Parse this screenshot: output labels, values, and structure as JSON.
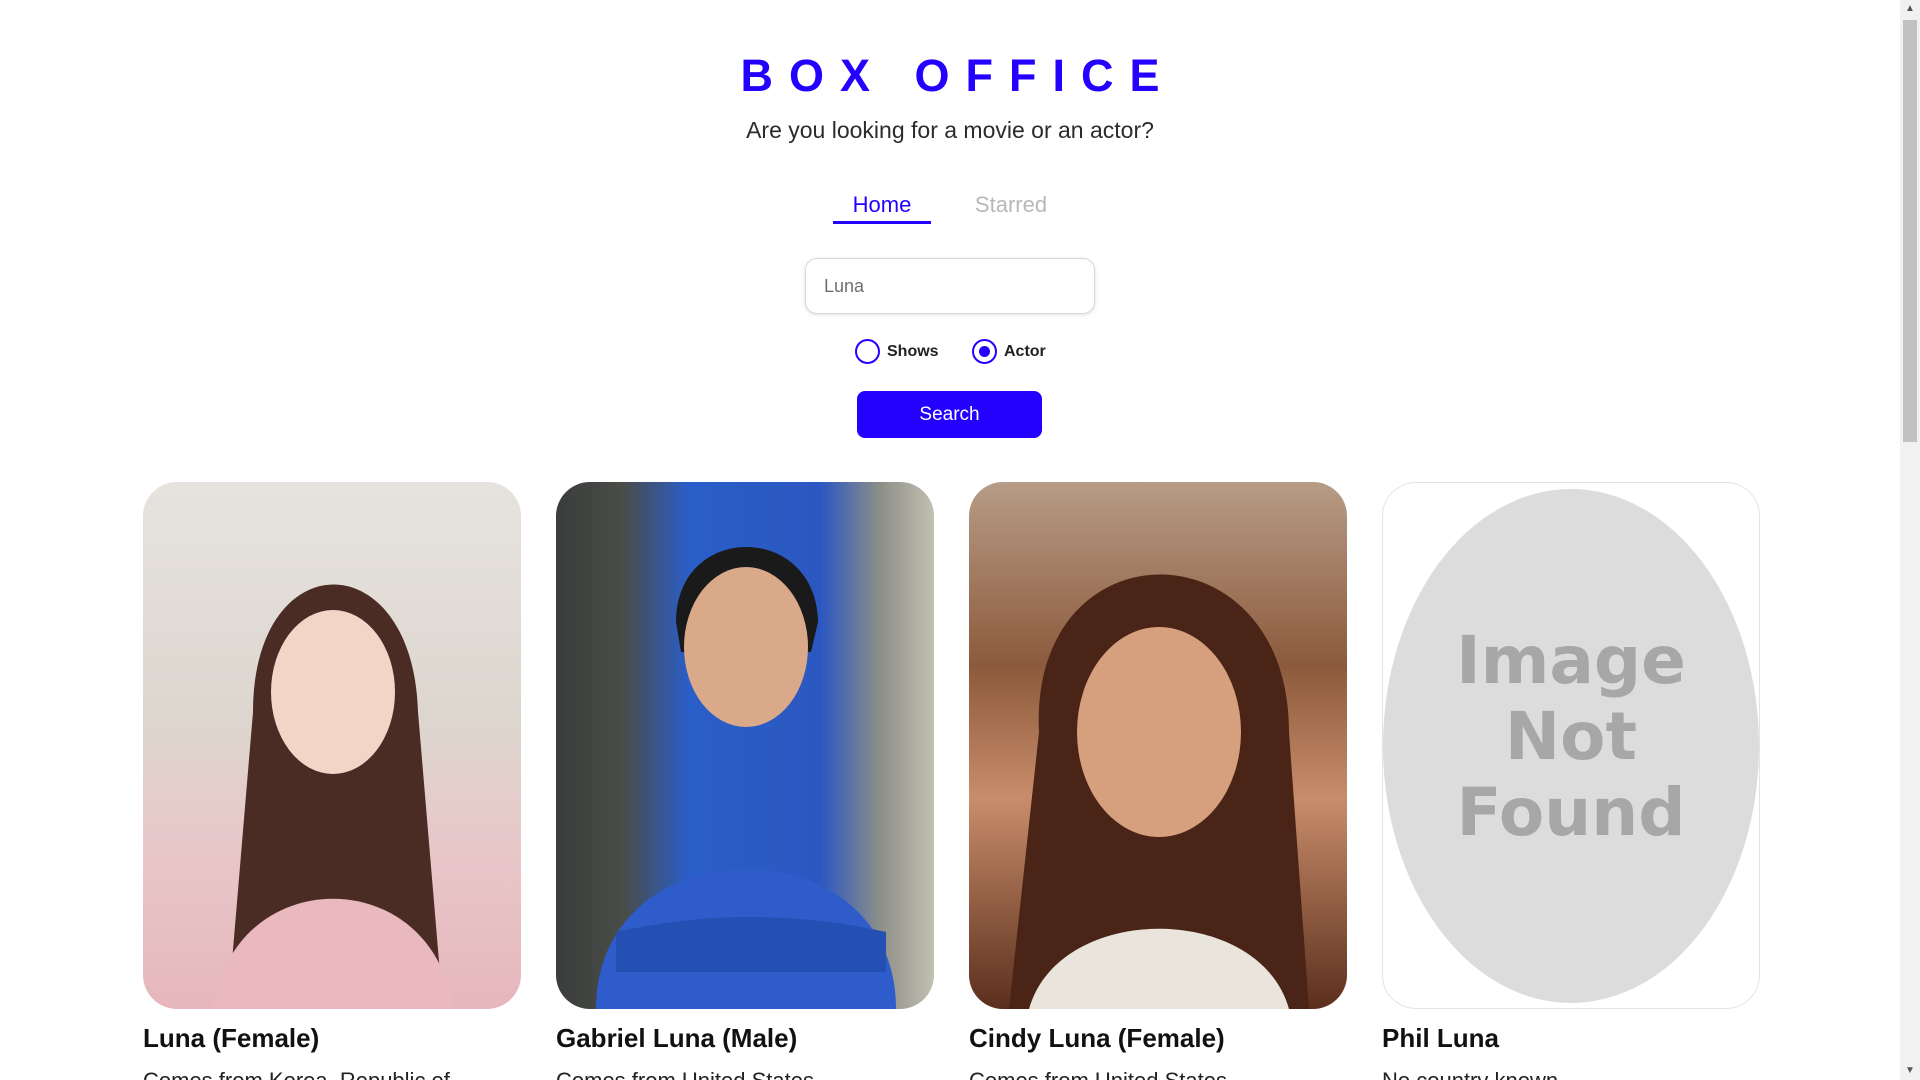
{
  "app": {
    "title": "BOX OFFICE",
    "subtitle": "Are you looking for a movie or an actor?"
  },
  "nav": {
    "tabs": [
      {
        "label": "Home",
        "active": true
      },
      {
        "label": "Starred",
        "active": false
      }
    ]
  },
  "search": {
    "value": "Luna",
    "button_label": "Search"
  },
  "search_type": {
    "options": [
      {
        "label": "Shows",
        "selected": false
      },
      {
        "label": "Actor",
        "selected": true
      }
    ]
  },
  "results": [
    {
      "name": "Luna (Female)",
      "country": "Comes from Korea, Republic of",
      "image": "photo"
    },
    {
      "name": "Gabriel Luna (Male)",
      "country": "Comes from United States",
      "image": "photo"
    },
    {
      "name": "Cindy Luna (Female)",
      "country": "Comes from United States",
      "image": "photo"
    },
    {
      "name": "Phil Luna",
      "country": "No country known",
      "image": "not-found",
      "placeholder_text": [
        "Image",
        "Not",
        "Found"
      ]
    }
  ],
  "colors": {
    "accent": "#2400ff",
    "inactive_tab": "#b8b8b8",
    "placeholder_bg": "#dcdcdc"
  }
}
